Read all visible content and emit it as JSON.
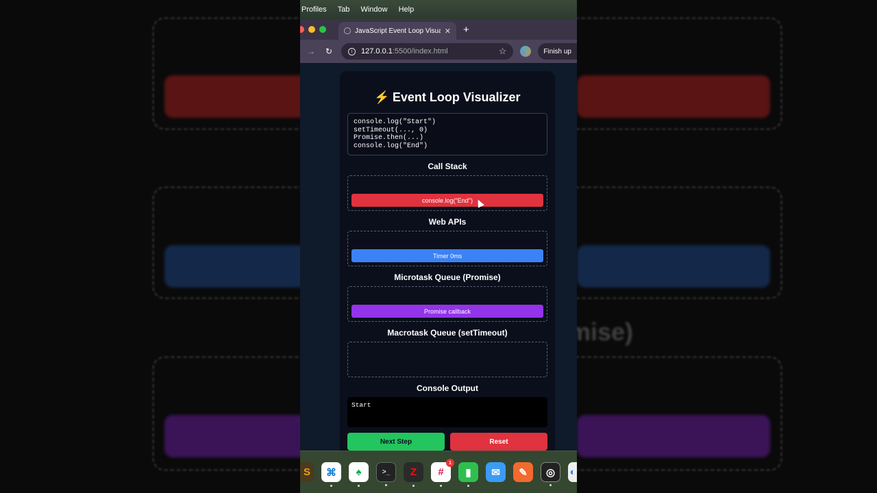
{
  "menubar": {
    "items": [
      "Profiles",
      "Tab",
      "Window",
      "Help"
    ]
  },
  "browser": {
    "tab_title": "JavaScript Event Loop Visualizer",
    "url_host": "127.0.0.1",
    "url_path": ":5500/index.html",
    "finish_label": "Finish up"
  },
  "app": {
    "title": "Event Loop Visualizer",
    "title_icon": "⚡",
    "code_lines": "console.log(\"Start\")\nsetTimeout(..., 0)\nPromise.then(...)\nconsole.log(\"End\")",
    "sections": {
      "call_stack": {
        "title": "Call Stack",
        "item": "console.log(\"End\")",
        "color": "#e0323f"
      },
      "web_apis": {
        "title": "Web APIs",
        "item": "Timer 0ms",
        "color": "#3b82f6"
      },
      "microtask": {
        "title": "Microtask Queue (Promise)",
        "item": "Promise callback",
        "color": "#9333ea"
      },
      "macrotask": {
        "title": "Macrotask Queue (setTimeout)",
        "item": null
      }
    },
    "console_title": "Console Output",
    "console_output": "Start",
    "buttons": {
      "next_label": "Next Step",
      "next_color": "#22c55e",
      "reset_label": "Reset",
      "reset_color": "#e0323f"
    }
  },
  "background": {
    "ghost_text": "mise)"
  },
  "dock": {
    "icons": [
      "sublime-icon",
      "vscode-icon",
      "mongodb-icon",
      "terminal-icon",
      "filezilla-icon",
      "slack-icon",
      "numbers-icon",
      "mail-icon",
      "pen-icon",
      "obs-icon",
      "safari-icon"
    ],
    "slack_badge": "1"
  }
}
